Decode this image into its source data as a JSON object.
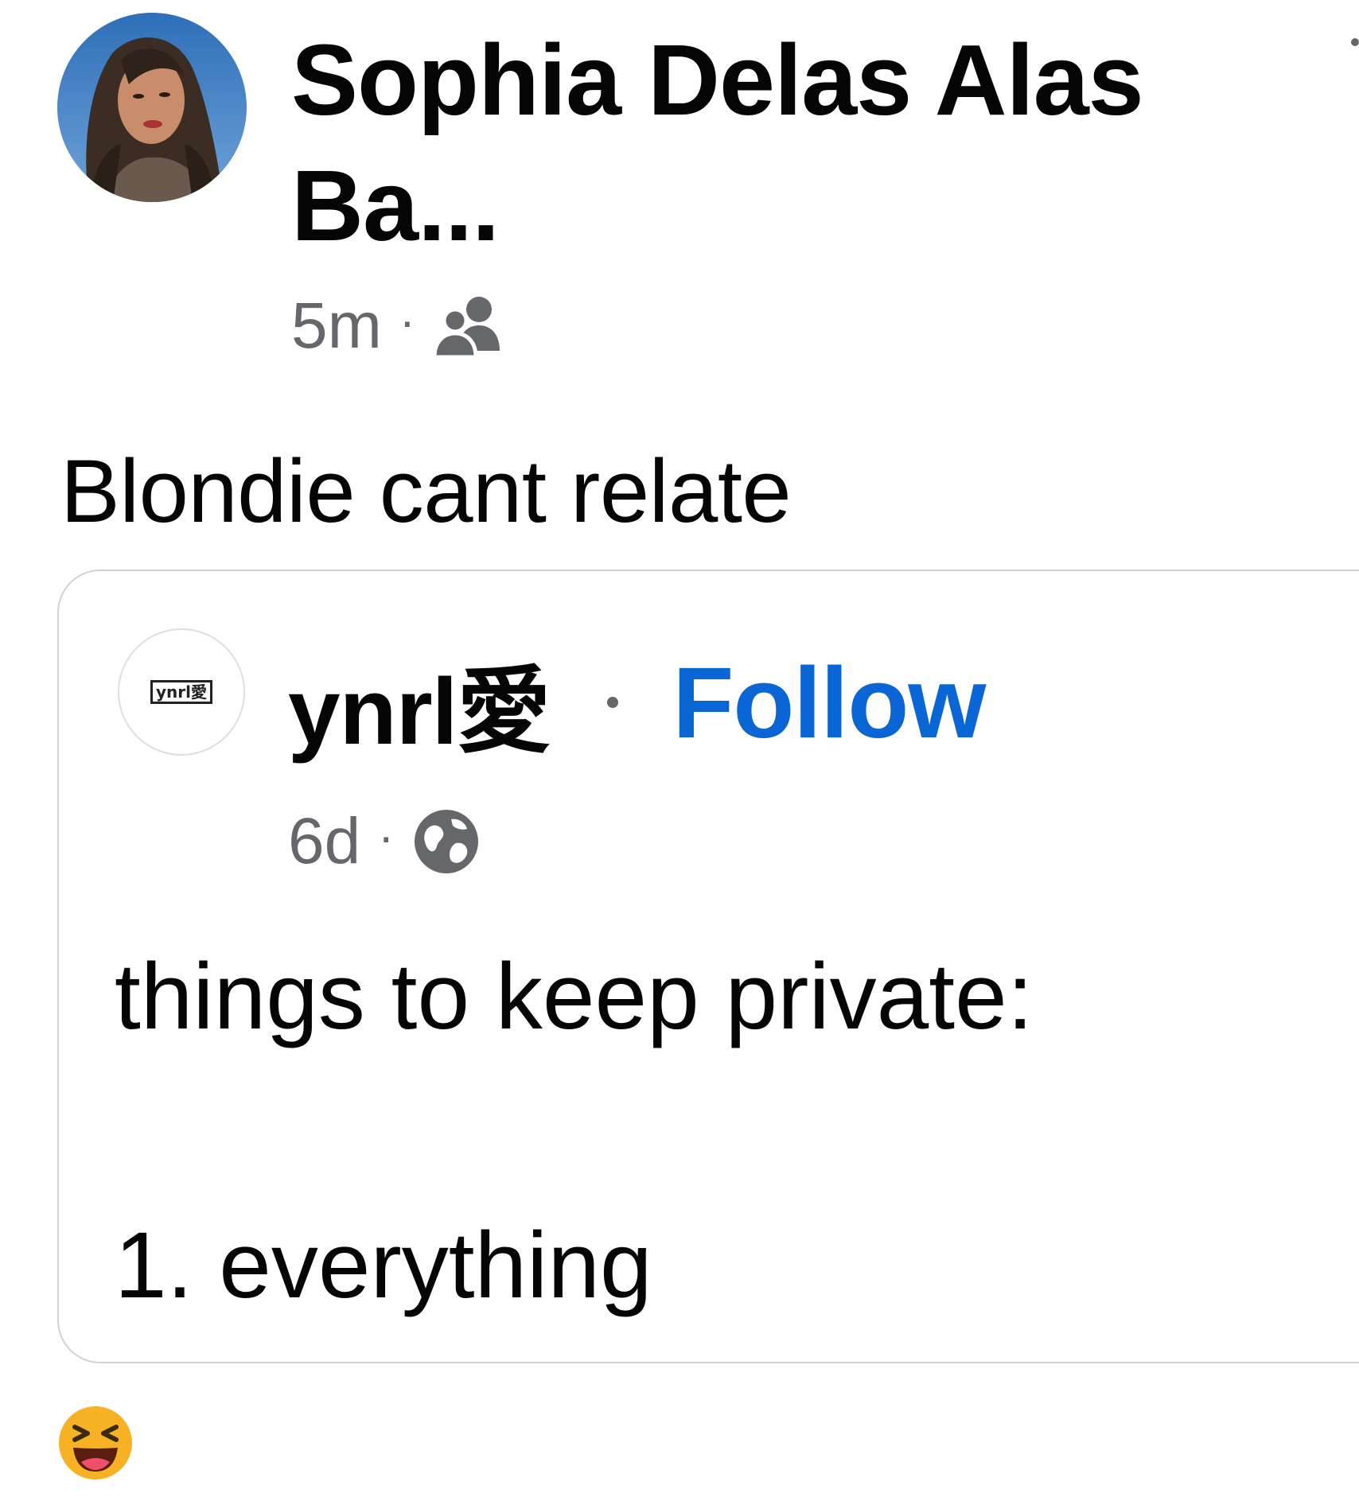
{
  "post": {
    "author": {
      "name": "Sophia Delas Alas Ba..."
    },
    "meta": {
      "time": "5m",
      "separator": "·",
      "audience_icon": "friends-icon"
    },
    "text": "Blondie cant relate",
    "more_icon": "more-options-icon"
  },
  "shared_post": {
    "author": {
      "name": "ynrl愛",
      "avatar_text": "ynrl愛"
    },
    "follow_label": "Follow",
    "meta": {
      "time": "6d",
      "separator": "·",
      "audience_icon": "globe-icon"
    },
    "body_line1": "things to keep private:",
    "body_line2": "1. everything"
  },
  "reaction": {
    "icon": "haha-reaction-icon"
  },
  "colors": {
    "text_primary": "#050505",
    "text_secondary": "#65676b",
    "link_blue": "#0a66d4",
    "card_border": "#d0d2d6",
    "background": "#ffffff",
    "reaction_yellow": "#f7b125"
  }
}
